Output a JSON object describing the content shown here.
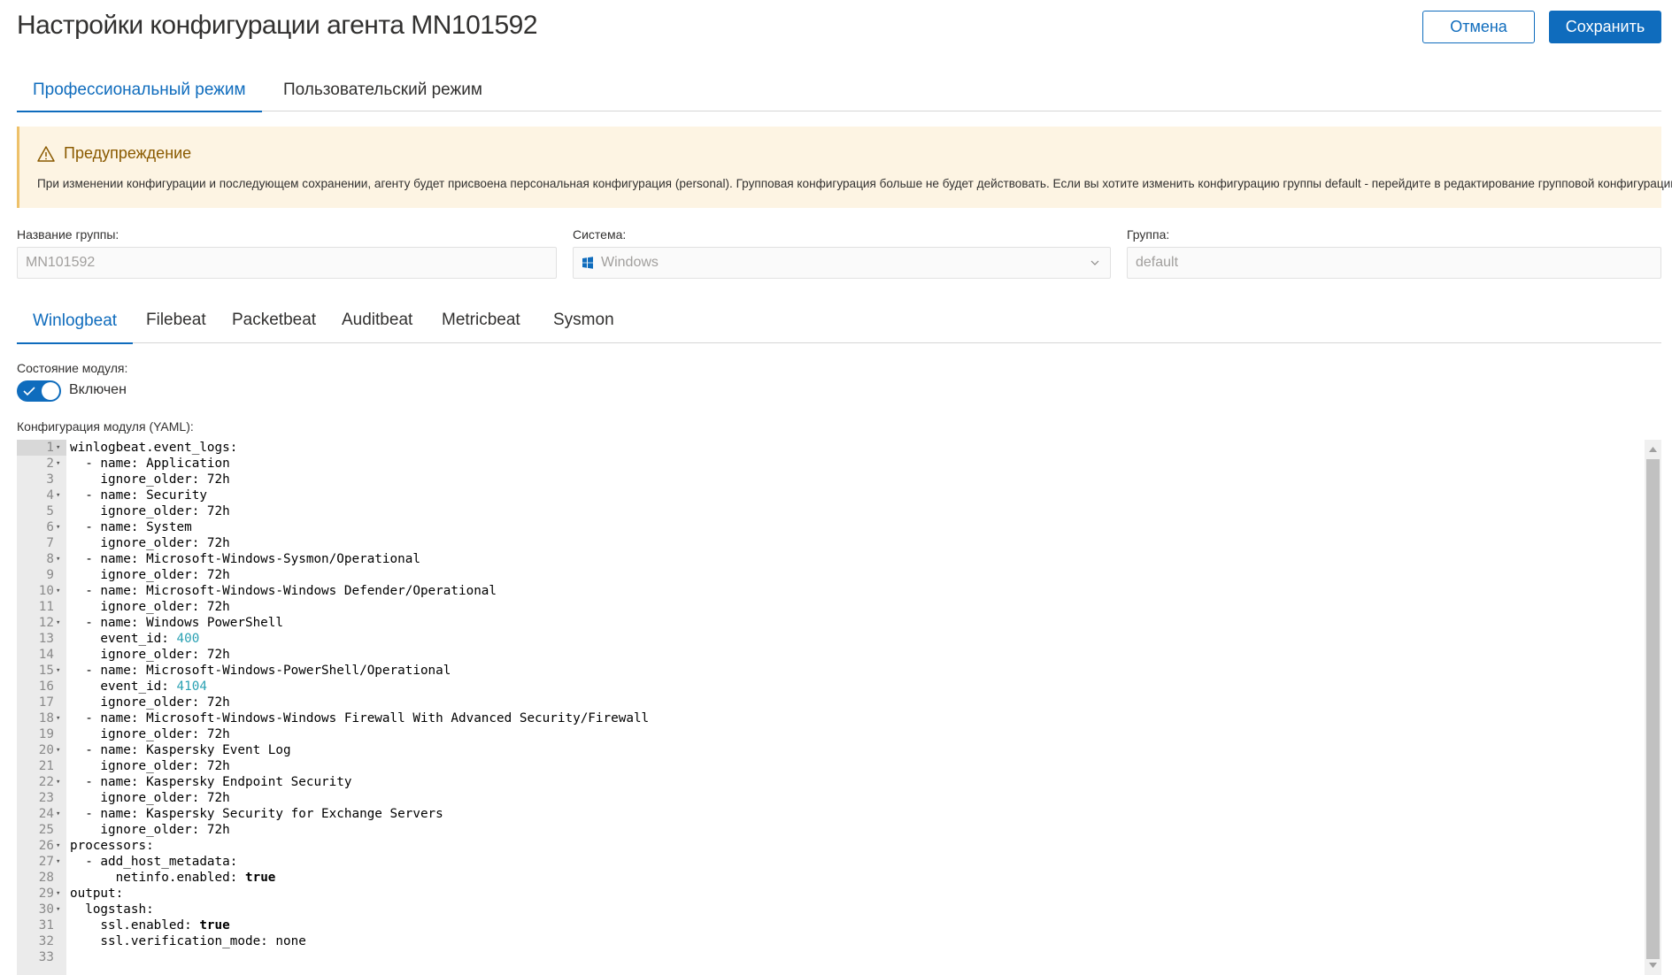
{
  "header": {
    "title": "Настройки конфигурации агента MN101592",
    "cancel_label": "Отмена",
    "save_label": "Сохранить"
  },
  "mode_tabs": [
    {
      "label": "Профессиональный режим",
      "active": true
    },
    {
      "label": "Пользовательский режим",
      "active": false
    }
  ],
  "warning": {
    "title": "Предупреждение",
    "text": "При изменении конфигурации и последующем сохранении, агенту будет присвоена персональная конфигурация (personal). Групповая конфигурация больше не будет действовать. Если вы хотите изменить конфигурацию группы default - перейдите в редактирование групповой конфигурации"
  },
  "form": {
    "group_name_label": "Название группы:",
    "group_name_value": "MN101592",
    "system_label": "Система:",
    "system_value": "Windows",
    "group_label": "Группа:",
    "group_value": "default"
  },
  "module_tabs": [
    {
      "label": "Winlogbeat",
      "active": true
    },
    {
      "label": "Filebeat",
      "active": false
    },
    {
      "label": "Packetbeat",
      "active": false
    },
    {
      "label": "Auditbeat",
      "active": false
    },
    {
      "label": "Metricbeat",
      "active": false
    },
    {
      "label": "Sysmon",
      "active": false
    }
  ],
  "module": {
    "state_label": "Состояние модуля:",
    "state_value": "Включен",
    "enabled": true,
    "yaml_label": "Конфигурация модуля (YAML):"
  },
  "editor": {
    "lines": [
      {
        "n": "1",
        "fold": true,
        "text": "winlogbeat.event_logs:"
      },
      {
        "n": "2",
        "fold": true,
        "text": "  - name: Application"
      },
      {
        "n": "3",
        "fold": false,
        "text": "    ignore_older: 72h"
      },
      {
        "n": "4",
        "fold": true,
        "text": "  - name: Security"
      },
      {
        "n": "5",
        "fold": false,
        "text": "    ignore_older: 72h"
      },
      {
        "n": "6",
        "fold": true,
        "text": "  - name: System"
      },
      {
        "n": "7",
        "fold": false,
        "text": "    ignore_older: 72h"
      },
      {
        "n": "8",
        "fold": true,
        "text": "  - name: Microsoft-Windows-Sysmon/Operational"
      },
      {
        "n": "9",
        "fold": false,
        "text": "    ignore_older: 72h"
      },
      {
        "n": "10",
        "fold": true,
        "text": "  - name: Microsoft-Windows-Windows Defender/Operational"
      },
      {
        "n": "11",
        "fold": false,
        "text": "    ignore_older: 72h"
      },
      {
        "n": "12",
        "fold": true,
        "text": "  - name: Windows PowerShell"
      },
      {
        "n": "13",
        "fold": false,
        "text": "    event_id: ",
        "num": "400"
      },
      {
        "n": "14",
        "fold": false,
        "text": "    ignore_older: 72h"
      },
      {
        "n": "15",
        "fold": true,
        "text": "  - name: Microsoft-Windows-PowerShell/Operational"
      },
      {
        "n": "16",
        "fold": false,
        "text": "    event_id: ",
        "num": "4104"
      },
      {
        "n": "17",
        "fold": false,
        "text": "    ignore_older: 72h"
      },
      {
        "n": "18",
        "fold": true,
        "text": "  - name: Microsoft-Windows-Windows Firewall With Advanced Security/Firewall"
      },
      {
        "n": "19",
        "fold": false,
        "text": "    ignore_older: 72h"
      },
      {
        "n": "20",
        "fold": true,
        "text": "  - name: Kaspersky Event Log"
      },
      {
        "n": "21",
        "fold": false,
        "text": "    ignore_older: 72h"
      },
      {
        "n": "22",
        "fold": true,
        "text": "  - name: Kaspersky Endpoint Security"
      },
      {
        "n": "23",
        "fold": false,
        "text": "    ignore_older: 72h"
      },
      {
        "n": "24",
        "fold": true,
        "text": "  - name: Kaspersky Security for Exchange Servers"
      },
      {
        "n": "25",
        "fold": false,
        "text": "    ignore_older: 72h"
      },
      {
        "n": "26",
        "fold": true,
        "text": "processors:"
      },
      {
        "n": "27",
        "fold": true,
        "text": "  - add_host_metadata:"
      },
      {
        "n": "28",
        "fold": false,
        "text": "      netinfo.enabled: ",
        "kw": "true"
      },
      {
        "n": "29",
        "fold": true,
        "text": "output:"
      },
      {
        "n": "30",
        "fold": true,
        "text": "  logstash:"
      },
      {
        "n": "31",
        "fold": false,
        "text": "    ssl.enabled: ",
        "kw": "true"
      },
      {
        "n": "32",
        "fold": false,
        "text": "    ssl.verification_mode: none"
      },
      {
        "n": "33",
        "fold": false,
        "text": ""
      }
    ]
  },
  "colors": {
    "accent": "#0f6cbd",
    "warning_bg": "#fdf4e3",
    "warning_text": "#8a5a00",
    "number": "#2aa1b3"
  }
}
